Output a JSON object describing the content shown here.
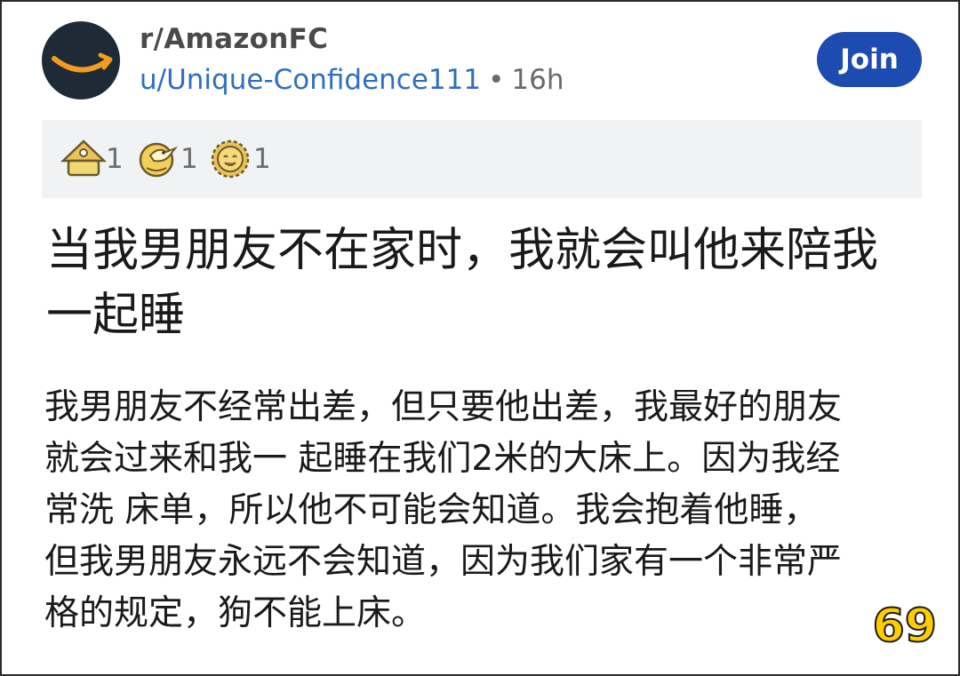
{
  "post": {
    "subreddit": "r/AmazonFC",
    "user": "u/Unique-Confidence111",
    "separator": "•",
    "age": "16h",
    "join_label": "Join",
    "awards": [
      {
        "icon": "helpful-hat-award-icon",
        "count": "1"
      },
      {
        "icon": "gold-bird-award-icon",
        "count": "1"
      },
      {
        "icon": "wholesome-sun-award-icon",
        "count": "1"
      }
    ],
    "title_line1": "当我男朋友不在家时，我就会叫他来陪我",
    "title_line2": "一起睡",
    "body_lines": [
      "我男朋友不经常出差，但只要他出差，我最好的朋友",
      "就会过来和我一 起睡在我们2米的大床上。因为我经",
      "常洗 床单，所以他不可能会知道。我会抱着他睡，",
      "但我男朋友永远不会知道，因为我们家有一个非常严",
      "格的规定，狗不能上床。"
    ],
    "badge": "69"
  },
  "colors": {
    "join_bg": "#1e4bb0",
    "user_link": "#2f6fbf",
    "avatar_bg": "#1e2b36",
    "amazon_orange": "#f39c1e",
    "awards_bg": "#f1f2f4",
    "badge": "#ffcc00"
  }
}
